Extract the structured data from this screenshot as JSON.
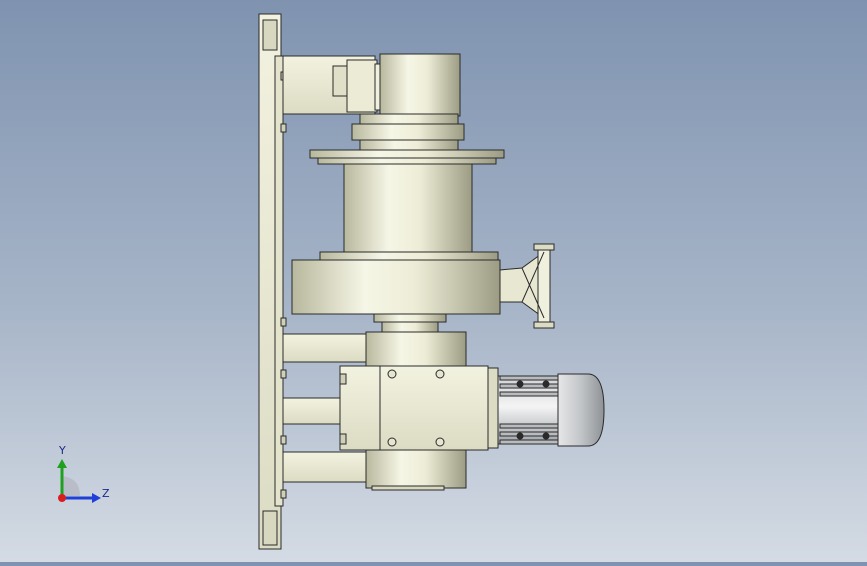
{
  "triad": {
    "y_label": "Y",
    "z_label": "Z",
    "y_color": "#1fa01f",
    "z_color": "#1f3fd8",
    "x_color": "#d81f1f"
  },
  "colors": {
    "background_top": "#7f93b0",
    "background_bottom": "#d4dbe4",
    "part_fill": "#eeeed8",
    "part_shade": "#c8c8b0",
    "outline": "#2a2a2a"
  }
}
